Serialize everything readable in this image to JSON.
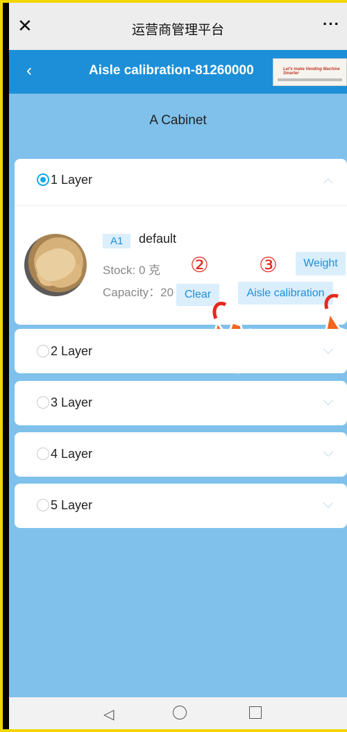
{
  "topbar": {
    "close_icon": "close-icon",
    "title": "运营商管理平台",
    "more_icon": "more-icon",
    "more_label": "···"
  },
  "header": {
    "back_label": "‹",
    "title": "Aisle calibration-81260000",
    "thumbnail_text": "Let's make Vending Machine Smarter"
  },
  "cabinet": {
    "title": "A Cabinet",
    "layers": [
      {
        "label": "1 Layer",
        "selected": true,
        "expanded": true
      },
      {
        "label": "2 Layer",
        "selected": false,
        "expanded": false
      },
      {
        "label": "3 Layer",
        "selected": false,
        "expanded": false
      },
      {
        "label": "4 Layer",
        "selected": false,
        "expanded": false
      },
      {
        "label": "5 Layer",
        "selected": false,
        "expanded": false
      }
    ]
  },
  "product": {
    "tag": "A1",
    "name": "default",
    "stock": "Stock: 0 克",
    "capacity": "Capacity：20",
    "buttons": {
      "clear": "Clear",
      "calibration": "Aisle calibration",
      "weight": "Weight"
    },
    "step_markers": [
      "②",
      "③"
    ]
  },
  "colors": {
    "header_blue": "#1d8fd8",
    "content_bg": "#7fc1eb",
    "radio_active": "#18a7e8",
    "button_bg": "#dbeefc",
    "marker_red": "#e4281e",
    "hand_orange": "#f26522"
  },
  "navbar": {
    "back_label": "◁",
    "home_icon": "home-circle-icon",
    "recent_icon": "recent-square-icon"
  }
}
